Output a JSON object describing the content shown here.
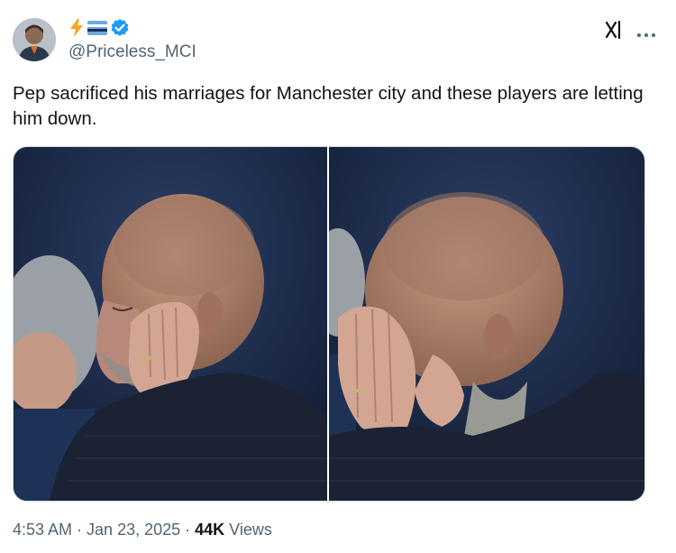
{
  "author": {
    "handle": "@Priceless_MCI",
    "name_emojis": [
      "lightning-bolt",
      "flag-stripes"
    ],
    "verified": true
  },
  "tweet": {
    "text": "Pep sacrificed his marriages for Manchester city and these players are letting him down."
  },
  "meta": {
    "time": "4:53 AM",
    "separator": "·",
    "date": "Jan 23, 2025",
    "views_count": "44K",
    "views_label": "Views"
  },
  "icons": {
    "grok": "grok-icon",
    "more": "more-options-icon",
    "verified": "verified-badge-icon"
  },
  "colors": {
    "verified_blue": "#1d9bf0",
    "secondary_text": "#536471",
    "primary_text": "#0f1419"
  }
}
